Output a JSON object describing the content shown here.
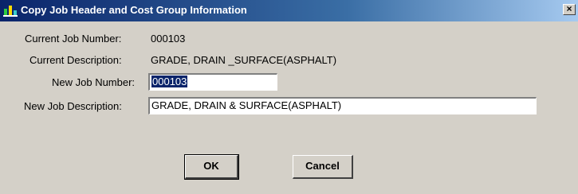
{
  "window": {
    "title": "Copy Job Header and Cost Group Information",
    "close_glyph": "×"
  },
  "fields": {
    "current_job_number_label": "Current Job Number:",
    "current_job_number_value": "000103",
    "current_description_label": "Current Description:",
    "current_description_value": "GRADE, DRAIN _SURFACE(ASPHALT)",
    "new_job_number_label": "New Job Number:",
    "new_job_number_value": "000103",
    "new_job_description_label": "New Job Description:",
    "new_job_description_value": "GRADE, DRAIN & SURFACE(ASPHALT)"
  },
  "buttons": {
    "ok_label": "OK",
    "cancel_label": "Cancel"
  },
  "colors": {
    "titlebar_start": "#0a246a",
    "titlebar_end": "#a6caf0",
    "dialog_bg": "#d4d0c8",
    "selection": "#0a246a"
  },
  "icons": {
    "app": "app-icon",
    "close": "close-icon"
  }
}
